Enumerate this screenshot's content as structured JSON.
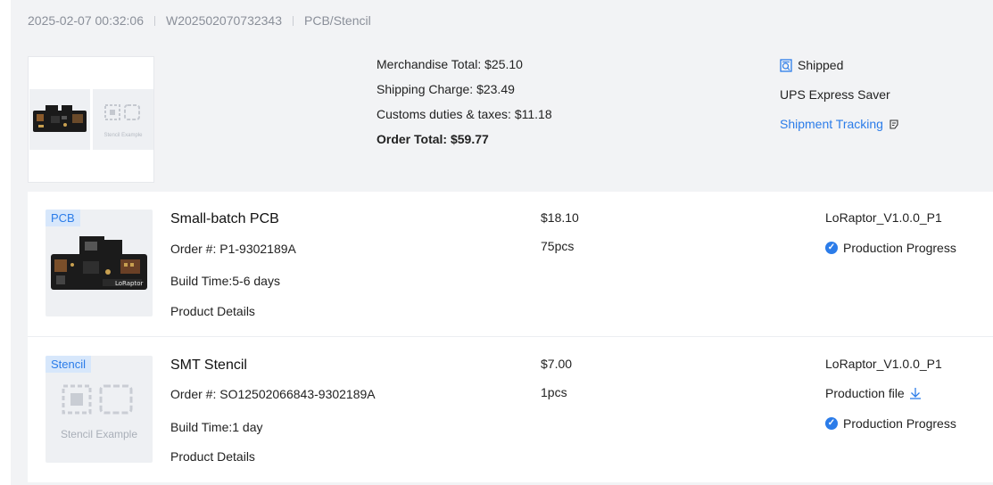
{
  "order": {
    "datetime": "2025-02-07 00:32:06",
    "number": "W202502070732343",
    "category": "PCB/Stencil"
  },
  "summary": {
    "stencil_example_label": "Stencil Example",
    "merchandise_total": "Merchandise Total: $25.10",
    "shipping_charge": "Shipping Charge: $23.49",
    "customs": "Customs duties & taxes: $11.18",
    "order_total": "Order Total: $59.77"
  },
  "shipping": {
    "status": "Shipped",
    "method": "UPS Express Saver",
    "tracking_link": "Shipment Tracking"
  },
  "items": [
    {
      "tag": "PCB",
      "title": "Small-batch PCB",
      "order_no": "Order #: P1-9302189A",
      "build_time": "Build Time:5-6 days",
      "details_link": "Product Details",
      "price": "$18.10",
      "qty": "75pcs",
      "file_name": "LoRaptor_V1.0.0_P1",
      "progress": "Production Progress"
    },
    {
      "tag": "Stencil",
      "title": "SMT Stencil",
      "order_no": "Order #: SO12502066843-9302189A",
      "build_time": "Build Time:1 day",
      "details_link": "Product Details",
      "price": "$7.00",
      "qty": "1pcs",
      "file_name": "LoRaptor_V1.0.0_P1",
      "production_file": "Production file",
      "progress": "Production Progress",
      "stencil_example_label": "Stencil Example"
    }
  ],
  "colors": {
    "accent": "#2b7ce9",
    "card_bg": "#f2f3f5",
    "muted_text": "#8a8f99"
  }
}
